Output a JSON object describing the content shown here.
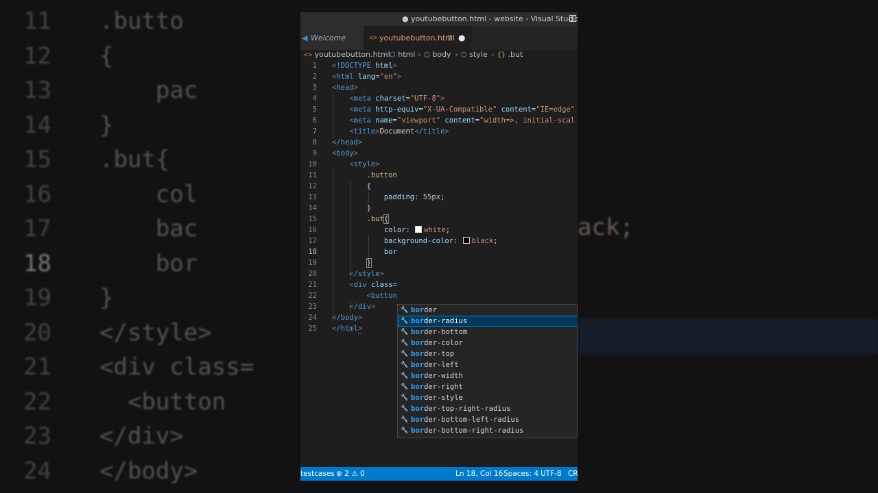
{
  "window": {
    "title": "● youtubebutton.html - website - Visual Studio Code"
  },
  "tabs": [
    {
      "label": "Welcome",
      "icon": "vscode-icon"
    },
    {
      "label": "youtubebutton.html",
      "problem_count": "2",
      "modified_indicator": "●",
      "icon": "html-file-icon"
    }
  ],
  "breadcrumb": [
    "youtubebutton.html",
    "html",
    "body",
    "style",
    ".but"
  ],
  "editor": {
    "current_line": 18,
    "line_numbers": [
      "1",
      "2",
      "3",
      "4",
      "5",
      "6",
      "7",
      "8",
      "9",
      "10",
      "11",
      "12",
      "13",
      "14",
      "15",
      "16",
      "17",
      "18",
      "19",
      "20",
      "21",
      "22",
      "23",
      "24",
      "25"
    ],
    "code": {
      "l1_tag": "!DOCTYPE",
      "l1_attr": "html",
      "l2_tag": "html",
      "l2_attr": "lang",
      "l2_val": "\"en\"",
      "l3_tag": "head",
      "l4_tag": "meta",
      "l4_attr": "charset",
      "l4_val": "\"UTF-8\"",
      "l5_tag": "meta",
      "l5_attr": "http-equiv",
      "l5_val": "\"X-UA-Compatible\"",
      "l5_attr2": "content",
      "l5_val2": "\"IE=edge\"",
      "l6_tag": "meta",
      "l6_attr": "name",
      "l6_val": "\"viewport\"",
      "l6_attr2": "content",
      "l6_val2": "\"width=>, initial-scal",
      "l7_tag": "title",
      "l7_text": "Document",
      "l7_tag_close": "/title",
      "l8_tag": "/head",
      "l9_tag": "body",
      "l10_tag": "style",
      "l11_sel": ".button",
      "l12_text": "{",
      "l13_prop": "padding",
      "l13_val": "55px",
      "l14_text": "}",
      "l15_sel": ".but",
      "l15_brace": "{",
      "l16_prop": "color",
      "l16_val": "white",
      "l17_prop": "background-color",
      "l17_val": "black",
      "l18_text": "bor",
      "l19_text": "}",
      "l20_tag": "/style",
      "l21_tag": "div",
      "l21_attr": "class=",
      "l22_tag": "button",
      "l23_tag": "/div",
      "l24_tag": "/body",
      "l25_tag": "/html"
    }
  },
  "suggestions": {
    "match": "bor",
    "selected_index": 1,
    "items": [
      {
        "label": "border",
        "rest": "der"
      },
      {
        "label": "border-radius",
        "rest": "der-radius"
      },
      {
        "label": "border-bottom",
        "rest": "der-bottom"
      },
      {
        "label": "border-color",
        "rest": "der-color"
      },
      {
        "label": "border-top",
        "rest": "der-top"
      },
      {
        "label": "border-left",
        "rest": "der-left"
      },
      {
        "label": "border-width",
        "rest": "der-width"
      },
      {
        "label": "border-right",
        "rest": "der-right"
      },
      {
        "label": "border-style",
        "rest": "der-style"
      },
      {
        "label": "border-top-right-radius",
        "rest": "der-top-right-radius"
      },
      {
        "label": "border-bottom-left-radius",
        "rest": "der-bottom-left-radius"
      },
      {
        "label": "border-bottom-right-radius",
        "rest": "der-bottom-right-radius"
      }
    ]
  },
  "statusbar": {
    "left_label": "testcases",
    "errors": "2",
    "warnings": "0",
    "cursor": "Ln 18, Col 16",
    "spaces": "Spaces: 4",
    "encoding": "UTF-8",
    "eol": "CR"
  },
  "background": {
    "rows": [
      {
        "ln": "11",
        "code": ".butto"
      },
      {
        "ln": "12",
        "code": "{"
      },
      {
        "ln": "13",
        "code": "    pac"
      },
      {
        "ln": "14",
        "code": "}"
      },
      {
        "ln": "15",
        "code": ".but{"
      },
      {
        "ln": "16",
        "code": "    col"
      },
      {
        "ln": "17",
        "code": "    bac"
      },
      {
        "ln": "18",
        "code": "    bor"
      },
      {
        "ln": "19",
        "code": "}"
      },
      {
        "ln": "20",
        "code": "</style>"
      },
      {
        "ln": "21",
        "code": "<div class="
      },
      {
        "ln": "22",
        "code": "  <button"
      },
      {
        "ln": "23",
        "code": "</div>"
      },
      {
        "ln": "24",
        "code": "</body>"
      }
    ],
    "right_fragment": "ack;"
  },
  "colors": {
    "accent": "#007acc",
    "editor_bg": "#1e1e1e",
    "selected_suggestion": "#04395e",
    "match_highlight": "#2aaaff"
  }
}
